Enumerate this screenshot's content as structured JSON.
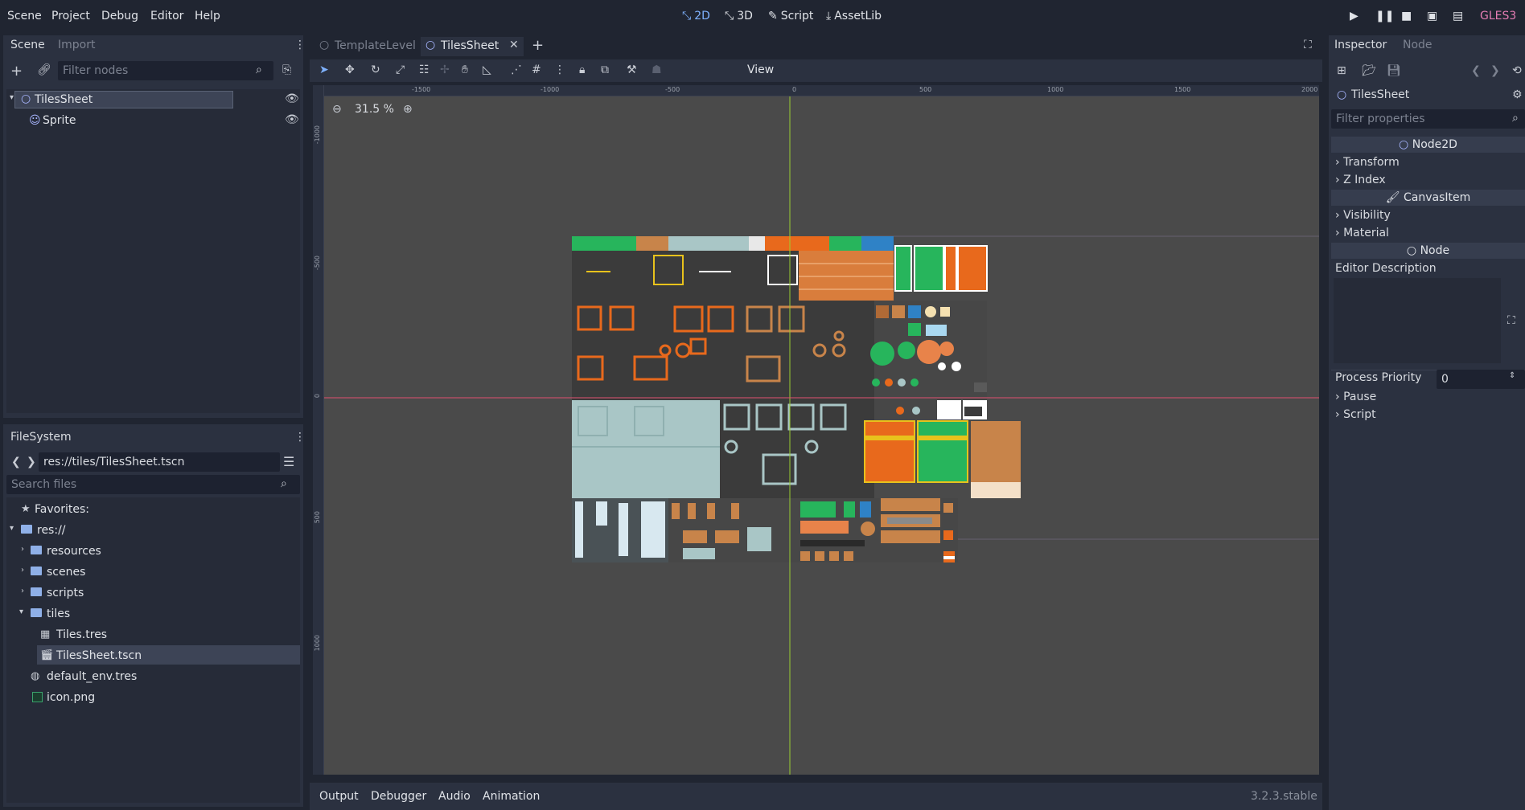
{
  "menu": {
    "scene": "Scene",
    "project": "Project",
    "debug": "Debug",
    "editor": "Editor",
    "help": "Help"
  },
  "modes": {
    "m2d": "2D",
    "m3d": "3D",
    "script": "Script",
    "assetlib": "AssetLib"
  },
  "renderer": "GLES3",
  "scene_dock": {
    "tab_scene": "Scene",
    "tab_import": "Import",
    "filter_placeholder": "Filter nodes",
    "nodes": [
      "TilesSheet",
      "Sprite"
    ]
  },
  "filesystem": {
    "title": "FileSystem",
    "path": "res://tiles/TilesSheet.tscn",
    "search_placeholder": "Search files",
    "favorites": "Favorites:",
    "root": "res://",
    "folders": [
      "resources",
      "scenes",
      "scripts",
      "tiles"
    ],
    "tiles_children": [
      "Tiles.tres",
      "TilesSheet.tscn"
    ],
    "root_files": [
      "default_env.tres",
      "icon.png"
    ]
  },
  "editor_tabs": [
    "TemplateLevel",
    "TilesSheet"
  ],
  "toolbar": {
    "view": "View"
  },
  "zoom": "31.5 %",
  "rulers": {
    "h": [
      "-1500",
      "-1000",
      "-500",
      "0",
      "500",
      "1000",
      "1500",
      "2000"
    ],
    "v": [
      "-1000",
      "-500",
      "0",
      "500",
      "1000"
    ]
  },
  "inspector": {
    "tab_inspector": "Inspector",
    "tab_node": "Node",
    "object": "TilesSheet",
    "filter_placeholder": "Filter properties",
    "section_node2d": "Node2D",
    "transform": "Transform",
    "zindex": "Z Index",
    "section_canvas": "CanvasItem",
    "visibility": "Visibility",
    "material": "Material",
    "section_node": "Node",
    "editor_description": "Editor Description",
    "process_priority": "Process Priority",
    "process_priority_value": "0",
    "pause": "Pause",
    "script": "Script"
  },
  "bottom": {
    "output": "Output",
    "debugger": "Debugger",
    "audio": "Audio",
    "animation": "Animation",
    "version": "3.2.3.stable"
  },
  "colors": {
    "accent": "#7fb2ff",
    "renderer": "#e57db4",
    "tile_orange": "#e8691c",
    "tile_green": "#27b55c",
    "tile_tan": "#c8844a",
    "tile_ice": "#a9c6c6",
    "tile_dark": "#3b3b3b"
  }
}
